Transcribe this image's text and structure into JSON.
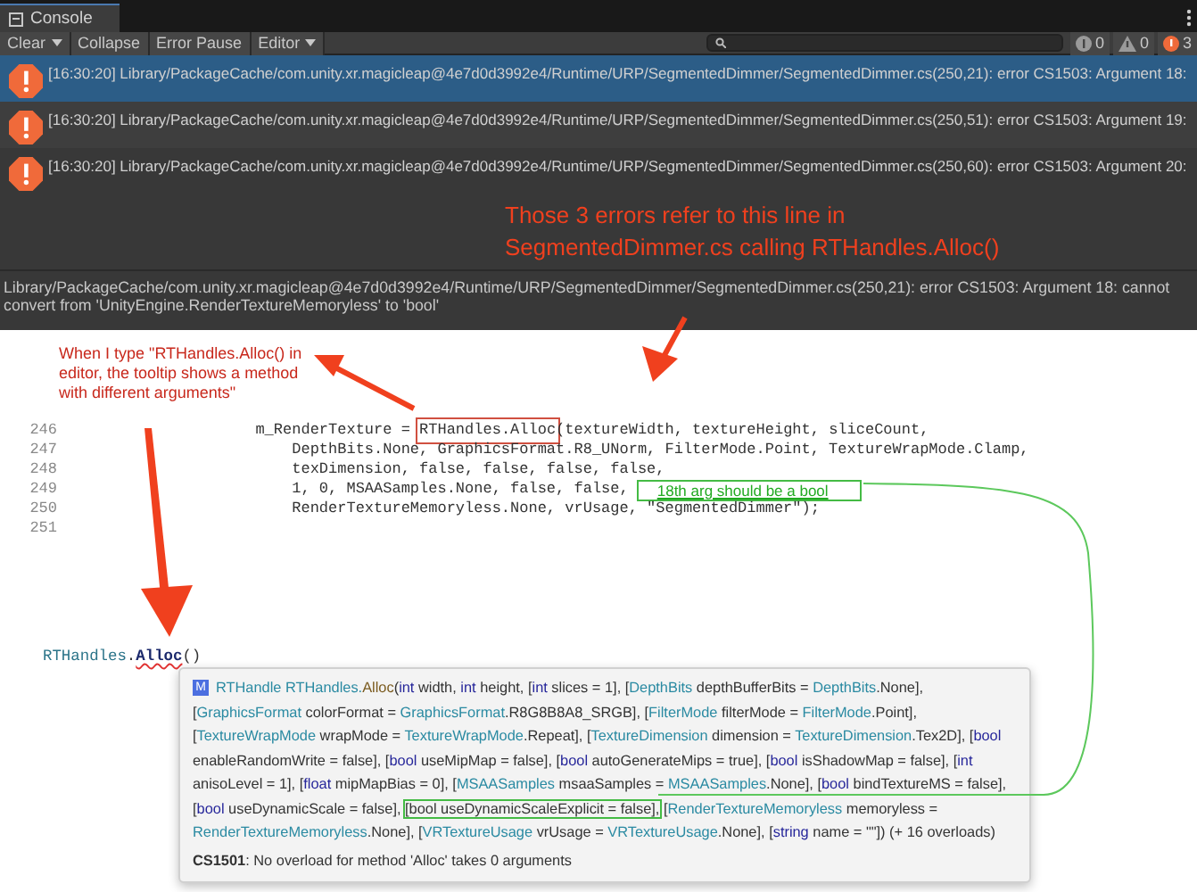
{
  "tab": {
    "label": "Console"
  },
  "toolbar": {
    "buttons": [
      {
        "label": "Clear",
        "dropdown": true
      },
      {
        "label": "Collapse",
        "dropdown": false
      },
      {
        "label": "Error Pause",
        "dropdown": false
      },
      {
        "label": "Editor",
        "dropdown": true
      }
    ],
    "counts": [
      {
        "kind": "info",
        "value": "0"
      },
      {
        "kind": "warning",
        "value": "0"
      },
      {
        "kind": "error",
        "value": "3"
      }
    ]
  },
  "log_rows": [
    {
      "text": "[16:30:20] Library/PackageCache/com.unity.xr.magicleap@4e7d0d3992e4/Runtime/URP/SegmentedDimmer/SegmentedDimmer.cs(250,21): error CS1503: Argument 18:",
      "selected": true
    },
    {
      "text": "[16:30:20] Library/PackageCache/com.unity.xr.magicleap@4e7d0d3992e4/Runtime/URP/SegmentedDimmer/SegmentedDimmer.cs(250,51): error CS1503: Argument 19:",
      "selected": false
    },
    {
      "text": "[16:30:20] Library/PackageCache/com.unity.xr.magicleap@4e7d0d3992e4/Runtime/URP/SegmentedDimmer/SegmentedDimmer.cs(250,60): error CS1503: Argument 20:",
      "selected": false
    }
  ],
  "detail": "Library/PackageCache/com.unity.xr.magicleap@4e7d0d3992e4/Runtime/URP/SegmentedDimmer/SegmentedDimmer.cs(250,21): error CS1503: Argument 18: cannot convert from 'UnityEngine.RenderTextureMemoryless' to 'bool'",
  "callout": "Those 3 errors refer to this line in SegmentedDimmer.cs calling RTHandles.Alloc()",
  "note": "When I type \"RTHandles.Alloc() in editor, the tooltip shows a method with different arguments\"",
  "code_lines": [
    {
      "number": "246",
      "segments": [
        {
          "text": "            m_RenderTexture = ",
          "boxed": false
        },
        {
          "text": "RTHandles.Alloc",
          "boxed": true
        },
        {
          "text": "(textureWidth, textureHeight, sliceCount,",
          "boxed": false
        }
      ]
    },
    {
      "number": "247",
      "segments": [
        {
          "text": "                DepthBits.None, GraphicsFormat.R8_UNorm, FilterMode.Point, TextureWrapMode.Clamp,",
          "boxed": false
        }
      ]
    },
    {
      "number": "248",
      "segments": [
        {
          "text": "                texDimension, false, false, false, false,",
          "boxed": false
        }
      ]
    },
    {
      "number": "249",
      "segments": [
        {
          "text": "                1, 0, MSAASamples.None, false, false,",
          "boxed": false
        }
      ],
      "note": "18th arg should be a bool"
    },
    {
      "number": "250",
      "segments": [
        {
          "text": "                RenderTextureMemoryless.None, vrUsage, \"SegmentedDimmer\");",
          "boxed": false
        }
      ]
    },
    {
      "number": "251"
    }
  ],
  "typed_line": [
    {
      "kind": "type",
      "text": "RTHandles"
    },
    {
      "kind": "plain",
      "text": "."
    },
    {
      "kind": "error",
      "text": "Alloc"
    },
    {
      "kind": "plain",
      "text": "()"
    }
  ],
  "tooltip": {
    "icon_letter": "M",
    "signature": [
      {
        "kind": "t",
        "text": "RTHandle RTHandles."
      },
      {
        "kind": "m",
        "text": "Alloc"
      },
      {
        "kind": "p",
        "text": "("
      },
      {
        "kind": "k",
        "text": "int"
      },
      {
        "kind": "p",
        "text": " width, "
      },
      {
        "kind": "k",
        "text": "int"
      },
      {
        "kind": "p",
        "text": " height, ["
      },
      {
        "kind": "k",
        "text": "int"
      },
      {
        "kind": "p",
        "text": " slices = 1], ["
      },
      {
        "kind": "t",
        "text": "DepthBits"
      },
      {
        "kind": "p",
        "text": " depthBufferBits = "
      },
      {
        "kind": "t",
        "text": "DepthBits"
      },
      {
        "kind": "p",
        "text": ".None], ["
      },
      {
        "kind": "t",
        "text": "GraphicsFormat"
      },
      {
        "kind": "p",
        "text": " colorFormat = "
      },
      {
        "kind": "t",
        "text": "GraphicsFormat"
      },
      {
        "kind": "p",
        "text": ".R8G8B8A8_SRGB], ["
      },
      {
        "kind": "t",
        "text": "FilterMode"
      },
      {
        "kind": "p",
        "text": " filterMode = "
      },
      {
        "kind": "t",
        "text": "FilterMode"
      },
      {
        "kind": "p",
        "text": ".Point], ["
      },
      {
        "kind": "t",
        "text": "TextureWrapMode"
      },
      {
        "kind": "p",
        "text": " wrapMode = "
      },
      {
        "kind": "t",
        "text": "TextureWrapMode"
      },
      {
        "kind": "p",
        "text": ".Repeat], ["
      },
      {
        "kind": "t",
        "text": "TextureDimension"
      },
      {
        "kind": "p",
        "text": " dimension = "
      },
      {
        "kind": "t",
        "text": "TextureDimension"
      },
      {
        "kind": "p",
        "text": ".Tex2D], ["
      },
      {
        "kind": "k",
        "text": "bool"
      },
      {
        "kind": "p",
        "text": " enableRandomWrite = false], ["
      },
      {
        "kind": "k",
        "text": "bool"
      },
      {
        "kind": "p",
        "text": " useMipMap = false], ["
      },
      {
        "kind": "k",
        "text": "bool"
      },
      {
        "kind": "p",
        "text": " autoGenerateMips = true], ["
      },
      {
        "kind": "k",
        "text": "bool"
      },
      {
        "kind": "p",
        "text": " isShadowMap = false], ["
      },
      {
        "kind": "k",
        "text": "int"
      },
      {
        "kind": "p",
        "text": " anisoLevel = 1], ["
      },
      {
        "kind": "k",
        "text": "float"
      },
      {
        "kind": "p",
        "text": " mipMapBias = 0], ["
      },
      {
        "kind": "t",
        "text": "MSAASamples"
      },
      {
        "kind": "p",
        "text": " msaaSamples = "
      },
      {
        "kind": "t",
        "text": "MSAASamples"
      },
      {
        "kind": "p",
        "text": ".None], ["
      },
      {
        "kind": "k",
        "text": "bool"
      },
      {
        "kind": "p",
        "text": " bindTextureMS = false], ["
      },
      {
        "kind": "k",
        "text": "bool"
      },
      {
        "kind": "p",
        "text": " useDynamicScale = false], "
      },
      {
        "kind": "highlight",
        "text": "[bool useDynamicScaleExplicit = false],"
      },
      {
        "kind": "p",
        "text": " ["
      },
      {
        "kind": "t",
        "text": "RenderTextureMemoryless"
      },
      {
        "kind": "p",
        "text": " memoryless = "
      },
      {
        "kind": "t",
        "text": "RenderTextureMemoryless"
      },
      {
        "kind": "p",
        "text": ".None], ["
      },
      {
        "kind": "t",
        "text": "VRTextureUsage"
      },
      {
        "kind": "p",
        "text": " vrUsage = "
      },
      {
        "kind": "t",
        "text": "VRTextureUsage"
      },
      {
        "kind": "p",
        "text": ".None], ["
      },
      {
        "kind": "k",
        "text": "string"
      },
      {
        "kind": "p",
        "text": " name = \"\"]) (+ 16 overloads)"
      }
    ],
    "error": "**CS1501**: No overload for method 'Alloc' takes 0 arguments"
  }
}
